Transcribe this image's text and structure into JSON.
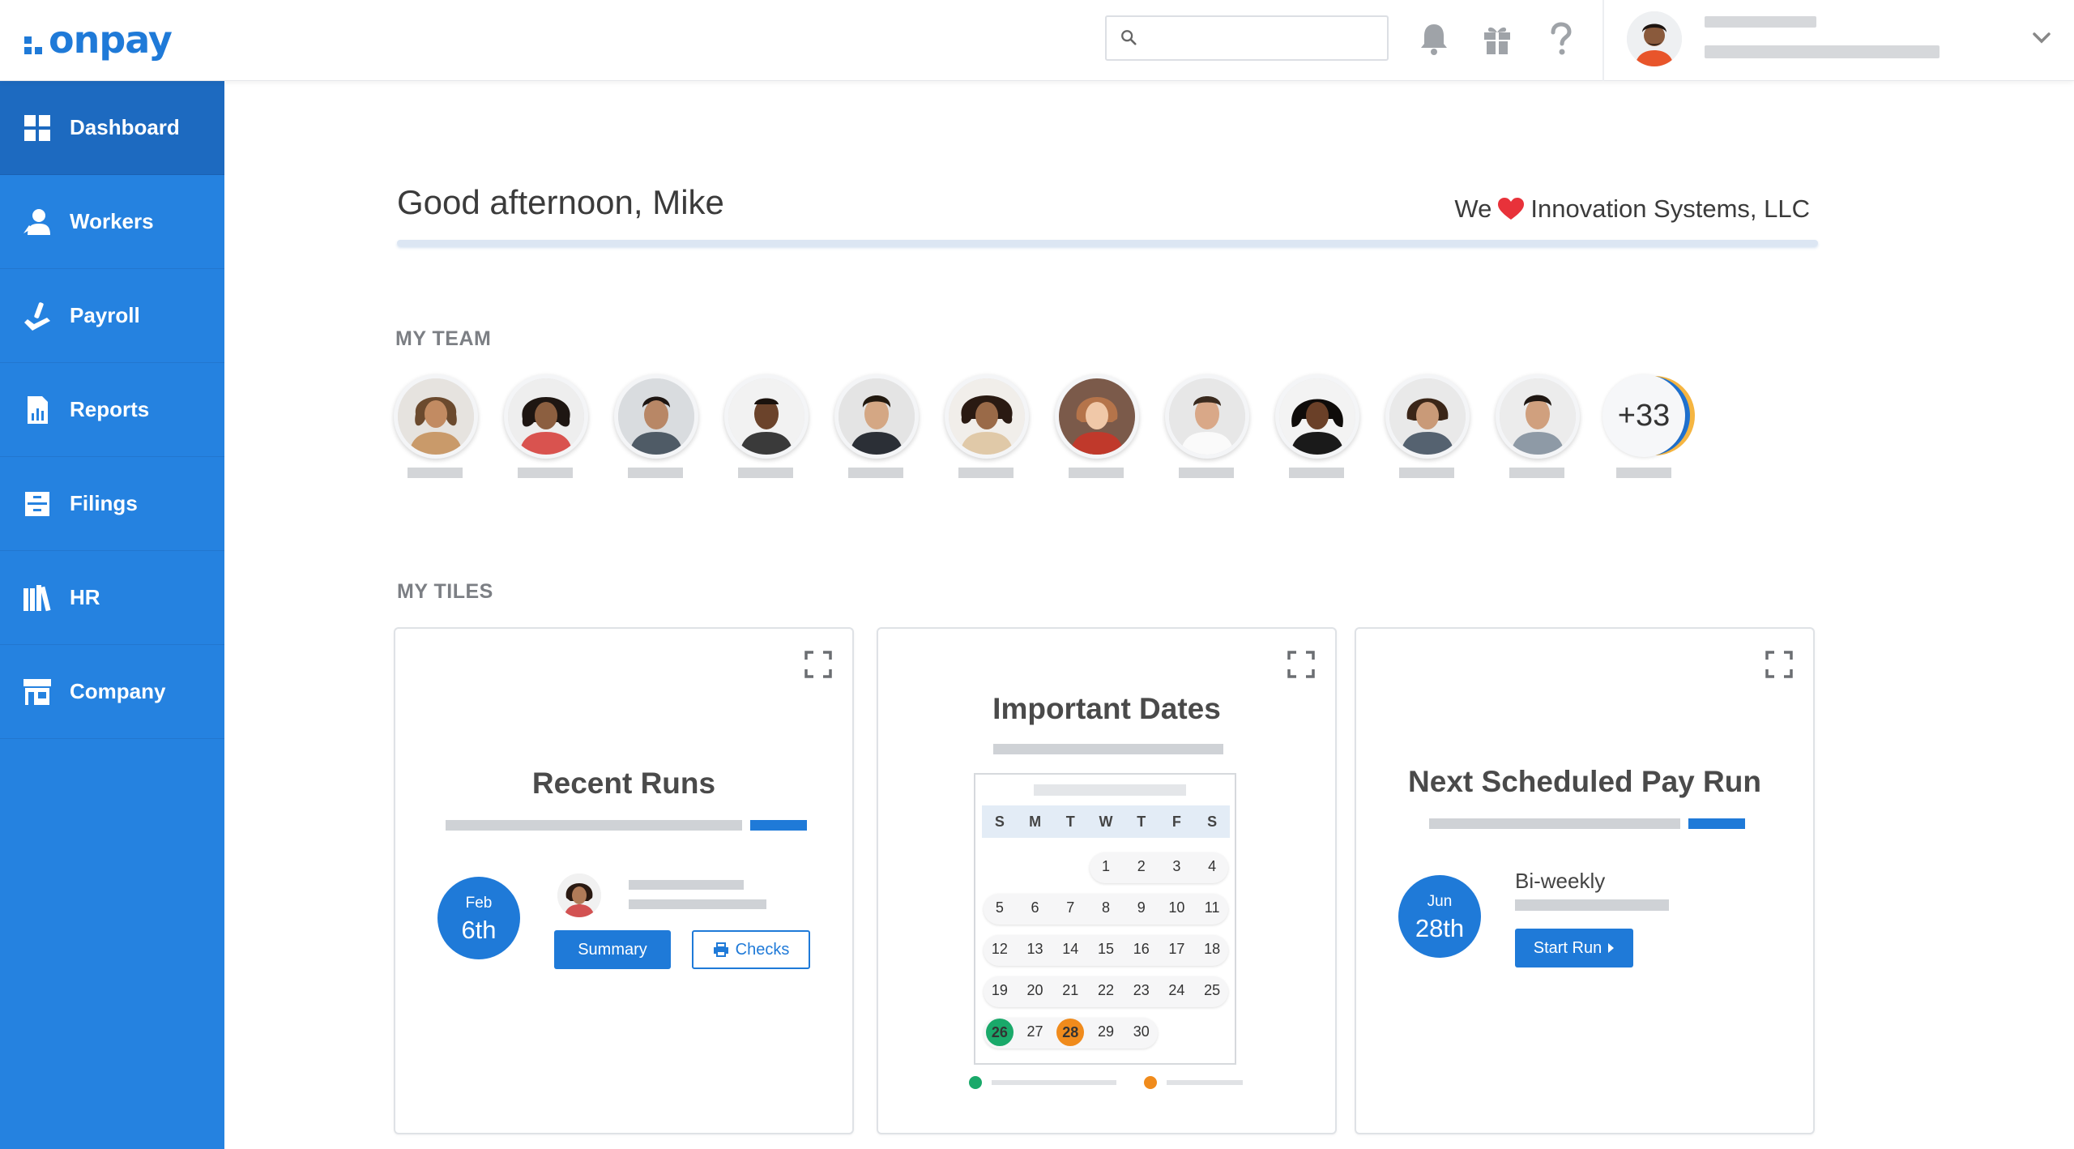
{
  "brand": {
    "logo_text": "onpay",
    "accent": "#1f7ad8"
  },
  "header": {
    "search": {
      "placeholder": "",
      "value": ""
    },
    "icons": [
      "bell-icon",
      "gift-icon",
      "help-icon"
    ]
  },
  "sidebar": {
    "items": [
      {
        "label": "Dashboard",
        "icon": "dashboard-icon",
        "active": true
      },
      {
        "label": "Workers",
        "icon": "workers-icon"
      },
      {
        "label": "Payroll",
        "icon": "payroll-icon"
      },
      {
        "label": "Reports",
        "icon": "reports-icon"
      },
      {
        "label": "Filings",
        "icon": "filings-icon"
      },
      {
        "label": "HR",
        "icon": "hr-icon"
      },
      {
        "label": "Company",
        "icon": "company-icon"
      }
    ]
  },
  "main": {
    "greeting": "Good afternoon, Mike",
    "loves_prefix": "We",
    "company": "Innovation Systems, LLC",
    "my_team_title": "MY TEAM",
    "team_more": "+33",
    "my_tiles_title": "MY TILES"
  },
  "tiles": {
    "recent_runs": {
      "title": "Recent Runs",
      "month": "Feb",
      "day": "6th",
      "summary_label": "Summary",
      "checks_label": "Checks"
    },
    "important_dates": {
      "title": "Important Dates",
      "weekdays": [
        "S",
        "M",
        "T",
        "W",
        "T",
        "F",
        "S"
      ],
      "rows": [
        [
          "",
          "",
          "",
          "1",
          "2",
          "3",
          "4"
        ],
        [
          "5",
          "6",
          "7",
          "8",
          "9",
          "10",
          "11"
        ],
        [
          "12",
          "13",
          "14",
          "15",
          "16",
          "17",
          "18"
        ],
        [
          "19",
          "20",
          "21",
          "22",
          "23",
          "24",
          "25"
        ],
        [
          "26",
          "27",
          "28",
          "29",
          "30",
          "",
          ""
        ]
      ],
      "highlight_green": "26",
      "highlight_orange": "28"
    },
    "next_pay_run": {
      "title": "Next Scheduled Pay Run",
      "month": "Jun",
      "day": "28th",
      "frequency": "Bi-weekly",
      "start_label": "Start Run"
    }
  }
}
